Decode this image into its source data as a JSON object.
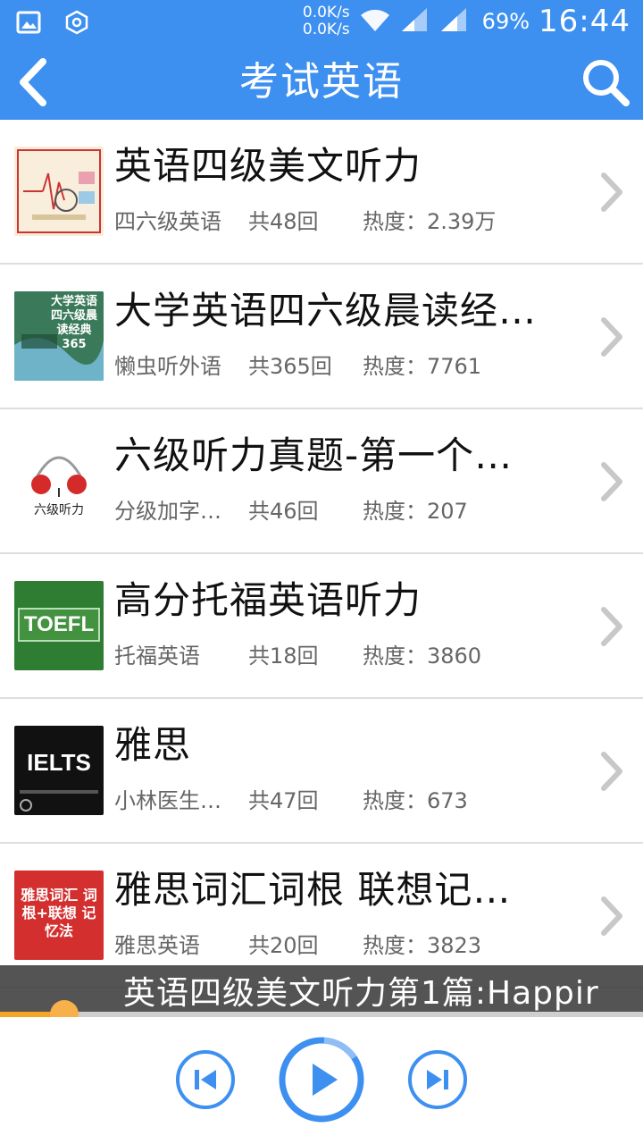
{
  "status_bar": {
    "net_up": "0.0K/s",
    "net_down": "0.0K/s",
    "battery": "69%",
    "time": "16:44",
    "icons": [
      "image-icon",
      "settings-hexagon-icon",
      "wifi-icon",
      "signal-1-icon",
      "signal-2-icon"
    ]
  },
  "header": {
    "title": "考试英语",
    "accent": "#3d8ff0"
  },
  "list": [
    {
      "title": "英语四级美文听力",
      "author": "四六级英语",
      "count": "共48回",
      "heat": "热度：2.39万",
      "thumb": "cet4-notebook-cover"
    },
    {
      "title": "大学英语四六级晨读经…",
      "author": "懒虫听外语",
      "count": "共365回",
      "heat": "热度：7761",
      "thumb": "morning-reading-cover",
      "thumb_text": "大学英语四六级晨读经典365"
    },
    {
      "title": "六级听力真题-第一个…",
      "author": "分级加字…",
      "count": "共46回",
      "heat": "热度：207",
      "thumb": "headphones-cover",
      "thumb_text": "六级听力"
    },
    {
      "title": "高分托福英语听力",
      "author": "托福英语",
      "count": "共18回",
      "heat": "热度：3860",
      "thumb": "toefl-cover",
      "thumb_text": "TOEFL"
    },
    {
      "title": "雅思",
      "author": "小林医生…",
      "count": "共47回",
      "heat": "热度：673",
      "thumb": "ielts-cover",
      "thumb_text": "IELTS"
    },
    {
      "title": "雅思词汇词根 联想记…",
      "author": "雅思英语",
      "count": "共20回",
      "heat": "热度：3823",
      "thumb": "ielts-vocab-cover",
      "thumb_text": "雅思词汇 词根+联想 记忆法"
    }
  ],
  "player": {
    "now_playing": "英语四级美文听力第1篇:Happir",
    "progress": 0.1,
    "accent": "#f5a623"
  }
}
